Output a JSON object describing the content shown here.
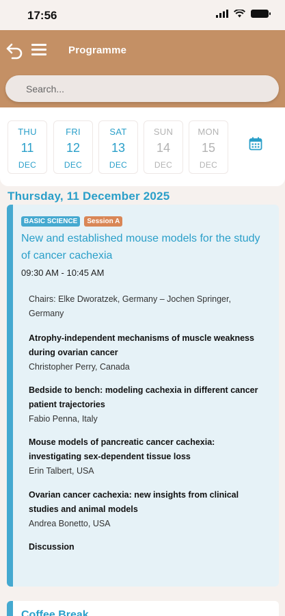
{
  "status": {
    "time": "17:56"
  },
  "header": {
    "title": "Programme",
    "back_icon": "back-arrow-icon",
    "menu_icon": "hamburger-menu-icon"
  },
  "search": {
    "placeholder": "Search..."
  },
  "dates": [
    {
      "dow": "THU",
      "day": "11",
      "month": "DEC",
      "state": "active"
    },
    {
      "dow": "FRI",
      "day": "12",
      "month": "DEC",
      "state": "active"
    },
    {
      "dow": "SAT",
      "day": "13",
      "month": "DEC",
      "state": "active"
    },
    {
      "dow": "SUN",
      "day": "14",
      "month": "DEC",
      "state": "inactive"
    },
    {
      "dow": "MON",
      "day": "15",
      "month": "DEC",
      "state": "inactive"
    }
  ],
  "day_heading": "Thursday, 11 December 2025",
  "session": {
    "tags": [
      "BASIC SCIENCE",
      "Session A"
    ],
    "title": "New and established mouse models for the study of cancer cachexia",
    "time": "09:30 AM - 10:45 AM",
    "chairs": "Chairs: Elke Dworatzek, Germany – Jochen Springer, Germany",
    "talks": [
      {
        "title": "Atrophy-independent mechanisms of muscle weakness during ovarian cancer",
        "speaker": "Christopher Perry, Canada"
      },
      {
        "title": "Bedside to bench: modeling cachexia in different cancer patient trajectories",
        "speaker": "Fabio Penna, Italy"
      },
      {
        "title": "Mouse models of pancreatic cancer cachexia: investigating sex-dependent tissue loss",
        "speaker": "Erin Talbert, USA"
      },
      {
        "title": "Ovarian cancer cachexia: new insights from clinical studies and animal models",
        "speaker": "Andrea Bonetto, USA"
      },
      {
        "title": "Discussion",
        "speaker": ""
      }
    ]
  },
  "next_session": {
    "title": "Coffee Break"
  },
  "colors": {
    "header": "#c49065",
    "accent": "#2a9fc9",
    "session_tag": "#d98656",
    "card_bg": "#e6f2f7"
  }
}
